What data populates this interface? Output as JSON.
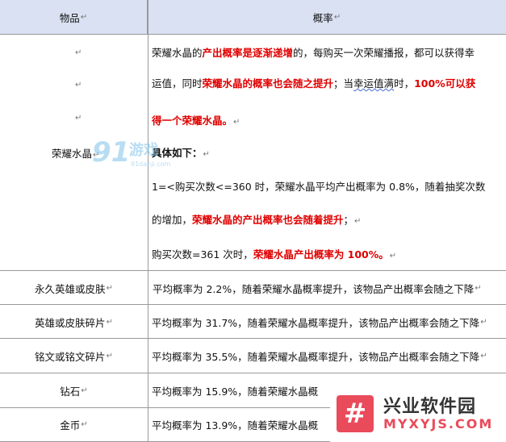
{
  "header": {
    "col1": "物品",
    "col2": "概率"
  },
  "para_mark": "↵",
  "glory_row": {
    "item": "荣耀水晶",
    "lines": [
      [
        {
          "t": "荣耀水晶的"
        },
        {
          "t": "产出概率是逐渐递增",
          "c": "red"
        },
        {
          "t": "的，每购买一次荣耀播报，都可以获得幸"
        }
      ],
      [
        {
          "t": "运值，同时"
        },
        {
          "t": "荣耀水晶的概率也会随之提升",
          "c": "red"
        },
        {
          "t": "；当"
        },
        {
          "t": "幸运值满",
          "c": "wavy"
        },
        {
          "t": "时，"
        },
        {
          "t": "100%可以获",
          "c": "red"
        }
      ],
      [
        {
          "t": "得一个荣耀水晶。",
          "c": "red"
        },
        {
          "t": "↵",
          "c": "mark"
        }
      ],
      [
        {
          "t": "具体如下：",
          "c": "b"
        },
        {
          "t": "↵",
          "c": "mark"
        }
      ],
      [
        {
          "t": "1=<购买次数<=360 时，荣耀水晶平均产出概率为 0.8%，随着抽奖次数"
        }
      ],
      [
        {
          "t": "的增加，"
        },
        {
          "t": "荣耀水晶的产出概率也会随着提升",
          "c": "red"
        },
        {
          "t": "；"
        },
        {
          "t": "↵",
          "c": "mark"
        }
      ],
      [
        {
          "t": "购买次数=361 次时，"
        },
        {
          "t": "荣耀水晶产出概率为 100%。",
          "c": "red"
        },
        {
          "t": "↵",
          "c": "mark"
        }
      ]
    ]
  },
  "rows": [
    {
      "item": "永久英雄或皮肤",
      "text": " 平均概率为 2.2%，随着荣耀水晶概率提升，该物品产出概率会随之下降"
    },
    {
      "item": "英雄或皮肤碎片",
      "text": "平均概率为 31.7%，随着荣耀水晶概率提升，该物品产出概率会随之下降"
    },
    {
      "item": "铭文或铭文碎片",
      "text": "平均概率为 35.5%，随着荣耀水晶概率提升，该物品产出概率会随之下降"
    },
    {
      "item": "钻石",
      "text": "平均概率为 15.9%，随着荣耀水晶概"
    },
    {
      "item": "金币",
      "text": "平均概率为 13.9%，随着荣耀水晶概"
    }
  ],
  "watermarks": {
    "site91_digits": "91",
    "site91_word": "游戏",
    "site91_domain": "91danji.com",
    "brand_glyph": "#",
    "brand_cn": "兴业软件园",
    "brand_en": "MYXYJS.COM"
  },
  "colors": {
    "header_bg": "#d9e1f2",
    "emphasis": "#e00000",
    "grid": "#999999"
  }
}
